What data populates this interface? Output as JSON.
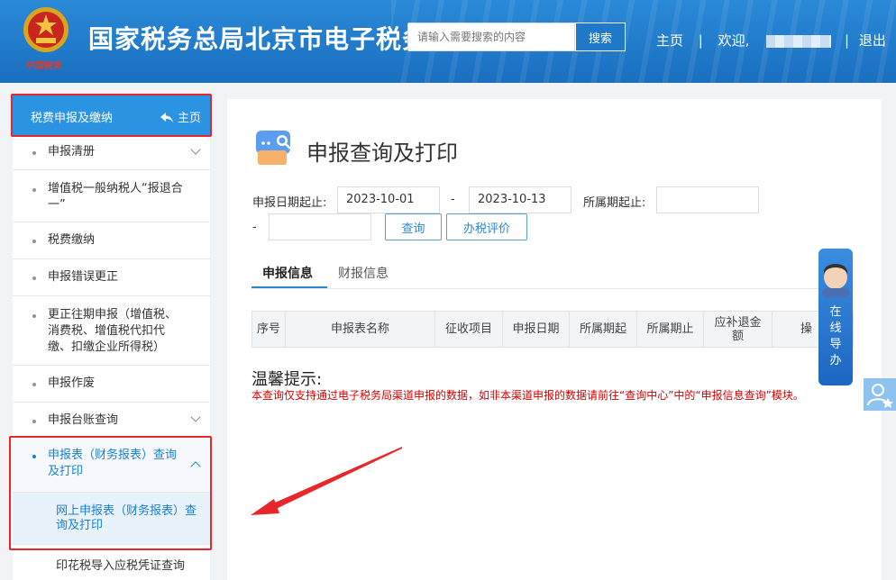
{
  "header": {
    "emblem_caption": "中国税务",
    "site_title": "国家税务总局北京市电子税务局",
    "search": {
      "placeholder": "请输入需要搜索的内容",
      "button": "搜索"
    },
    "nav": {
      "home": "主页",
      "welcome": "欢迎,",
      "logout": "退出",
      "sep": "|"
    }
  },
  "sidebar": {
    "header": {
      "label": "税费申报及缴纳",
      "home": "主页"
    },
    "items": [
      {
        "label": "申报清册",
        "chevron": "down"
      },
      {
        "label": "增值税一般纳税人“报退合一”"
      },
      {
        "label": "税费缴纳"
      },
      {
        "label": "申报错误更正"
      },
      {
        "label": "更正往期申报（增值税、消费税、增值税代扣代缴、扣缴企业所得税）"
      },
      {
        "label": "申报作废"
      },
      {
        "label": "申报台账查询",
        "chevron": "down"
      },
      {
        "label": "申报表（财务报表）查询及打印",
        "chevron": "up",
        "active": true
      }
    ],
    "subitems": [
      {
        "label": "网上申报表（财务报表）查询及打印",
        "active": true
      },
      {
        "label": "印花税导入应税凭证查询"
      }
    ]
  },
  "main": {
    "title": "申报查询及打印",
    "form": {
      "date_label": "申报日期起止:",
      "date_start": "2023-10-01",
      "dash": "-",
      "date_end": "2023-10-13",
      "period_label": "所属期起止:",
      "period_start": "",
      "period_end": "",
      "query_button": "查询",
      "rate_button": "办税评价"
    },
    "tabs": [
      {
        "label": "申报信息",
        "active": true
      },
      {
        "label": "财报信息"
      }
    ],
    "table_headers": [
      "序号",
      "申报表名称",
      "征收项目",
      "申报日期",
      "所属期起",
      "所属期止",
      "应补退金额",
      "操"
    ],
    "tips": {
      "title": "温馨提示:",
      "body": "本查询仅支持通过电子税务局渠道申报的数据，如非本渠道申报的数据请前往“查询中心”中的“申报信息查询”模块。"
    }
  },
  "float": {
    "guide": "在线导办"
  },
  "colors": {
    "header": "#1f7bcc",
    "accent": "#2a94e3",
    "highlight": "#e8272b",
    "tip": "#d40000"
  }
}
